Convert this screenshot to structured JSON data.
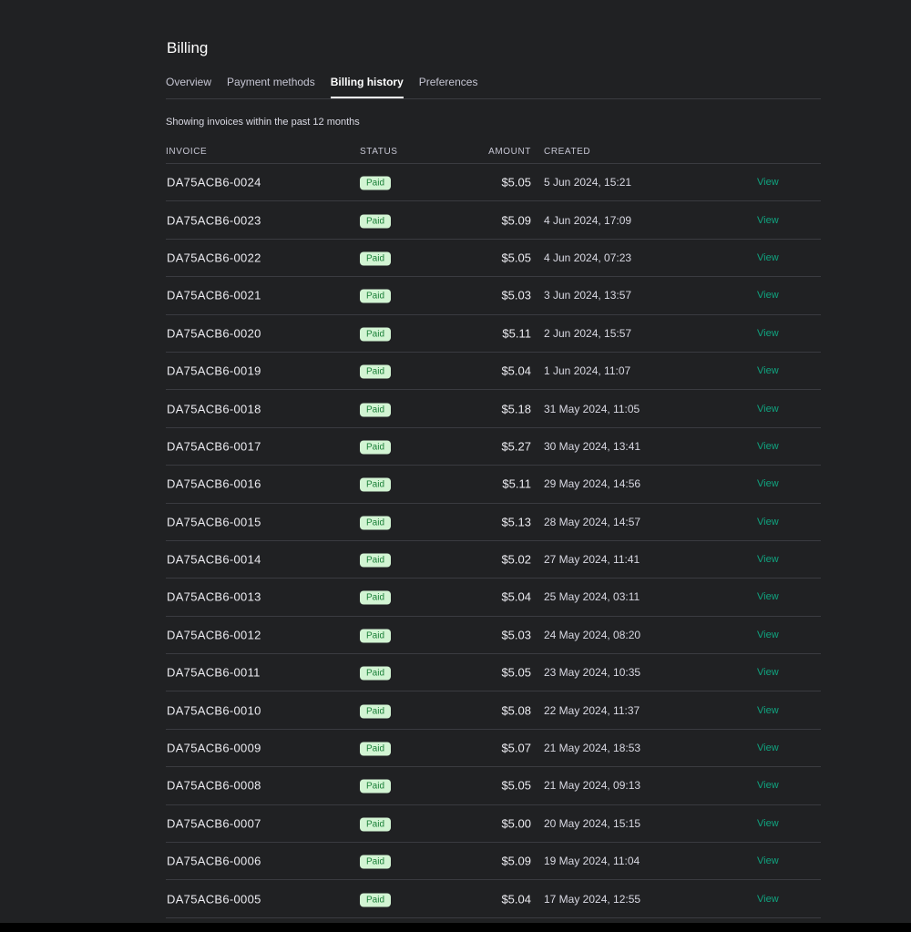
{
  "page": {
    "title": "Billing",
    "note": "Showing invoices within the past 12 months"
  },
  "tabs": [
    {
      "label": "Overview"
    },
    {
      "label": "Payment methods"
    },
    {
      "label": "Billing history"
    },
    {
      "label": "Preferences"
    }
  ],
  "active_tab": "Billing history",
  "table": {
    "headers": {
      "invoice": "INVOICE",
      "status": "STATUS",
      "amount": "AMOUNT",
      "created": "CREATED"
    },
    "rows": [
      {
        "invoice": "DA75ACB6-0024",
        "status": "Paid",
        "amount": "$5.05",
        "created": "5 Jun 2024, 15:21",
        "action": "View"
      },
      {
        "invoice": "DA75ACB6-0023",
        "status": "Paid",
        "amount": "$5.09",
        "created": "4 Jun 2024, 17:09",
        "action": "View"
      },
      {
        "invoice": "DA75ACB6-0022",
        "status": "Paid",
        "amount": "$5.05",
        "created": "4 Jun 2024, 07:23",
        "action": "View"
      },
      {
        "invoice": "DA75ACB6-0021",
        "status": "Paid",
        "amount": "$5.03",
        "created": "3 Jun 2024, 13:57",
        "action": "View"
      },
      {
        "invoice": "DA75ACB6-0020",
        "status": "Paid",
        "amount": "$5.11",
        "created": "2 Jun 2024, 15:57",
        "action": "View"
      },
      {
        "invoice": "DA75ACB6-0019",
        "status": "Paid",
        "amount": "$5.04",
        "created": "1 Jun 2024, 11:07",
        "action": "View"
      },
      {
        "invoice": "DA75ACB6-0018",
        "status": "Paid",
        "amount": "$5.18",
        "created": "31 May 2024, 11:05",
        "action": "View"
      },
      {
        "invoice": "DA75ACB6-0017",
        "status": "Paid",
        "amount": "$5.27",
        "created": "30 May 2024, 13:41",
        "action": "View"
      },
      {
        "invoice": "DA75ACB6-0016",
        "status": "Paid",
        "amount": "$5.11",
        "created": "29 May 2024, 14:56",
        "action": "View"
      },
      {
        "invoice": "DA75ACB6-0015",
        "status": "Paid",
        "amount": "$5.13",
        "created": "28 May 2024, 14:57",
        "action": "View"
      },
      {
        "invoice": "DA75ACB6-0014",
        "status": "Paid",
        "amount": "$5.02",
        "created": "27 May 2024, 11:41",
        "action": "View"
      },
      {
        "invoice": "DA75ACB6-0013",
        "status": "Paid",
        "amount": "$5.04",
        "created": "25 May 2024, 03:11",
        "action": "View"
      },
      {
        "invoice": "DA75ACB6-0012",
        "status": "Paid",
        "amount": "$5.03",
        "created": "24 May 2024, 08:20",
        "action": "View"
      },
      {
        "invoice": "DA75ACB6-0011",
        "status": "Paid",
        "amount": "$5.05",
        "created": "23 May 2024, 10:35",
        "action": "View"
      },
      {
        "invoice": "DA75ACB6-0010",
        "status": "Paid",
        "amount": "$5.08",
        "created": "22 May 2024, 11:37",
        "action": "View"
      },
      {
        "invoice": "DA75ACB6-0009",
        "status": "Paid",
        "amount": "$5.07",
        "created": "21 May 2024, 18:53",
        "action": "View"
      },
      {
        "invoice": "DA75ACB6-0008",
        "status": "Paid",
        "amount": "$5.05",
        "created": "21 May 2024, 09:13",
        "action": "View"
      },
      {
        "invoice": "DA75ACB6-0007",
        "status": "Paid",
        "amount": "$5.00",
        "created": "20 May 2024, 15:15",
        "action": "View"
      },
      {
        "invoice": "DA75ACB6-0006",
        "status": "Paid",
        "amount": "$5.09",
        "created": "19 May 2024, 11:04",
        "action": "View"
      },
      {
        "invoice": "DA75ACB6-0005",
        "status": "Paid",
        "amount": "$5.04",
        "created": "17 May 2024, 12:55",
        "action": "View"
      }
    ]
  },
  "colors": {
    "background": "#202123",
    "accent_link": "#10a37f",
    "badge_bg": "#d2f4d3",
    "badge_text": "#1a7f37",
    "divider": "#3a3b40"
  }
}
